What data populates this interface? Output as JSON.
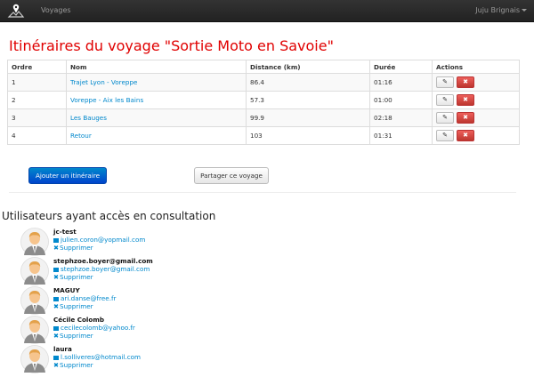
{
  "navbar": {
    "link": "Voyages",
    "user": "Juju Brignais"
  },
  "title": "Itinéraires du voyage \"Sortie Moto en Savoie\"",
  "table": {
    "headers": [
      "Ordre",
      "Nom",
      "Distance (km)",
      "Durée",
      "Actions"
    ],
    "rows": [
      {
        "ordre": "1",
        "nom": "Trajet Lyon - Voreppe",
        "distance": "86.4",
        "duree": "01:16"
      },
      {
        "ordre": "2",
        "nom": "Voreppe - Aix les Bains",
        "distance": "57.3",
        "duree": "01:00"
      },
      {
        "ordre": "3",
        "nom": "Les Bauges",
        "distance": "99.9",
        "duree": "02:18"
      },
      {
        "ordre": "4",
        "nom": "Retour",
        "distance": "103",
        "duree": "01:31"
      }
    ],
    "edit_icon": "pencil-icon",
    "delete_icon": "remove-icon"
  },
  "buttons": {
    "add": "Ajouter un itinéraire",
    "share": "Partager ce voyage"
  },
  "section_title": "Utilisateurs ayant accès en consultation",
  "users": [
    {
      "name": "jc-test",
      "email": "julien.coron@yopmail.com",
      "remove": "Supprimer"
    },
    {
      "name": "stephzoe.boyer@gmail.com",
      "email": "stephzoe.boyer@gmail.com",
      "remove": "Supprimer"
    },
    {
      "name": "MAGUY",
      "email": "ari.danse@free.fr",
      "remove": "Supprimer"
    },
    {
      "name": "Cécile Colomb",
      "email": "cecilecolomb@yahoo.fr",
      "remove": "Supprimer"
    },
    {
      "name": "laura",
      "email": "l.solliveres@hotmail.com",
      "remove": "Supprimer"
    }
  ],
  "colors": {
    "title": "#e00000",
    "link": "#0088cc",
    "navbar": "#222222",
    "danger": "#da4f49",
    "primary": "#0066cc"
  }
}
